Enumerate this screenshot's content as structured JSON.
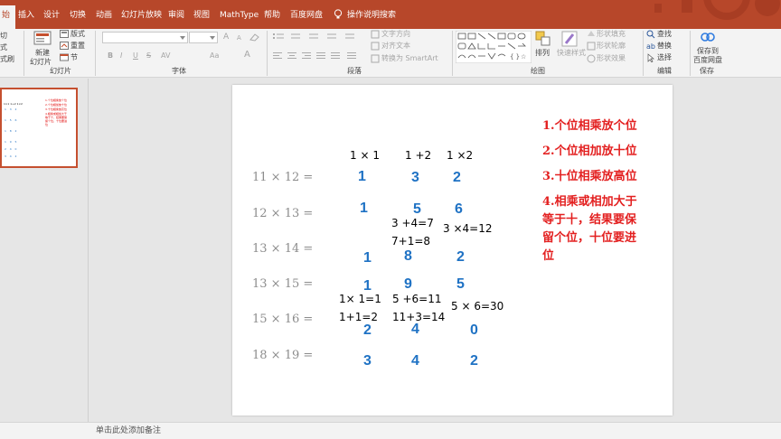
{
  "tabs": [
    "始",
    "插入",
    "设计",
    "切换",
    "动画",
    "幻灯片放映",
    "审阅",
    "视图",
    "MathType",
    "帮助",
    "百度网盘",
    "操作说明搜索"
  ],
  "ribbon": {
    "left_cut": [
      "切",
      "式",
      "式刷"
    ],
    "slides_group": {
      "new_slide": "新建",
      "new_slide_sub": "幻灯片",
      "layout": "版式",
      "reset": "重置",
      "section": "节",
      "label": "幻灯片"
    },
    "font_group": {
      "label": "字体",
      "grow": "A",
      "shrink": "A",
      "bold": "B",
      "italic": "I",
      "underline": "U",
      "strike": "S",
      "spacing": "AV",
      "case": "Aa",
      "color": "A"
    },
    "para_group": {
      "label": "段落",
      "text_direction": "文字方向",
      "align_text": "对齐文本",
      "smartart": "转换为 SmartArt"
    },
    "drawing_group": {
      "label": "绘图",
      "arrange": "排列",
      "quick_styles": "快速样式",
      "shape_fill": "形状填充",
      "shape_outline": "形状轮廓",
      "shape_effects": "形状效果"
    },
    "editing_group": {
      "label": "编辑",
      "find": "查找",
      "replace": "替换",
      "select": "选择"
    },
    "save_group": {
      "label": "保存",
      "save_to": "保存到",
      "baidu": "百度网盘"
    }
  },
  "thumbnail": {
    "number": "1",
    "lines": [
      "1×1  1+2  1×2",
      "1.个位相乘放个位",
      "2.个位相加放十位",
      "3.十位相乘放高位",
      "4.相乘或相加大于",
      "等于十，结果要保",
      "留个位，十位要进",
      "位"
    ]
  },
  "slide": {
    "equations": [
      "11 × 12 =",
      "12 × 13 =",
      "13 × 14 =",
      "13 × 15 =",
      "15 × 16 =",
      "18 × 19 ="
    ],
    "header_notes": [
      "1 × 1",
      "1 +2",
      "1 ×2"
    ],
    "answers": {
      "r1": [
        "1",
        "3",
        "2"
      ],
      "r2": [
        "1",
        "5",
        "6"
      ],
      "r3": [
        "1",
        "8",
        "2"
      ],
      "r4": [
        "1",
        "9",
        "5"
      ],
      "r5": [
        "2",
        "4",
        "0"
      ],
      "r6": [
        "3",
        "4",
        "2"
      ]
    },
    "work_notes": {
      "a": "3 +4=7",
      "b": "7+1=8",
      "c": "3 ×4=12",
      "d": "1× 1=1",
      "e": "1+1=2",
      "f": "5 +6=11",
      "g": "11+3=14",
      "h": "5 × 6=30"
    },
    "rules": [
      "1.个位相乘放个位",
      "2.个位相加放十位",
      "3.十位相乘放高位",
      "4.相乘或相加大于",
      "等于十，结果要保",
      "留个位，十位要进",
      "位"
    ]
  },
  "notes_placeholder": "单击此处添加备注",
  "colors": {
    "accent": "#b7472a",
    "answer": "#1f72c4",
    "rule": "#e32020"
  }
}
